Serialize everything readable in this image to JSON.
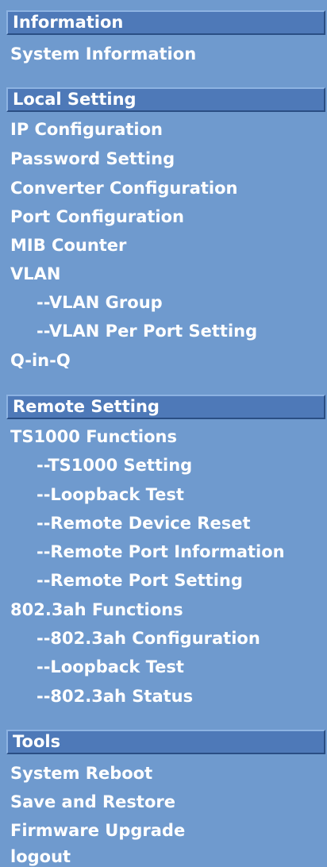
{
  "sections": [
    {
      "header": "Information",
      "items": [
        {
          "label": "System Information"
        }
      ]
    },
    {
      "header": "Local Setting",
      "items": [
        {
          "label": "IP Configuration"
        },
        {
          "label": "Password Setting"
        },
        {
          "label": "Converter Configuration"
        },
        {
          "label": "Port Configuration"
        },
        {
          "label": "MIB Counter"
        },
        {
          "label": "VLAN"
        },
        {
          "label": "--VLAN Group"
        },
        {
          "label": "--VLAN Per Port Setting"
        },
        {
          "label": "Q-in-Q"
        }
      ]
    },
    {
      "header": "Remote Setting",
      "items": [
        {
          "label": "TS1000 Functions"
        },
        {
          "label": "--TS1000 Setting"
        },
        {
          "label": "--Loopback Test"
        },
        {
          "label": "--Remote Device Reset"
        },
        {
          "label": "--Remote Port Information"
        },
        {
          "label": "--Remote Port Setting"
        },
        {
          "label": "802.3ah Functions"
        },
        {
          "label": "--802.3ah Configuration"
        },
        {
          "label": "--Loopback Test"
        },
        {
          "label": "--802.3ah Status"
        }
      ]
    },
    {
      "header": "Tools",
      "items": [
        {
          "label": "System Reboot"
        },
        {
          "label": "Save and Restore"
        },
        {
          "label": "Firmware Upgrade"
        },
        {
          "label": "logout"
        }
      ]
    }
  ]
}
